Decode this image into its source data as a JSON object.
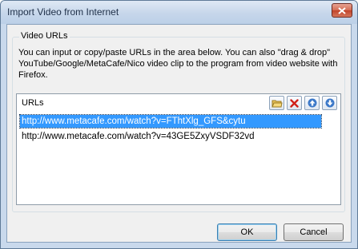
{
  "window": {
    "title": "Import Video from Internet",
    "close_icon": "close-icon"
  },
  "group": {
    "legend": "Video URLs",
    "description": "You can input or copy/paste URLs in the area below. You can also \"drag & drop\" YouTube/Google/MetaCafe/Nico video clip to the program from video website with Firefox."
  },
  "urls": {
    "header_label": "URLs",
    "toolbar": [
      {
        "name": "open-folder-icon"
      },
      {
        "name": "delete-icon"
      },
      {
        "name": "move-up-icon"
      },
      {
        "name": "move-down-icon"
      }
    ],
    "items": [
      {
        "text": "http://www.metacafe.com/watch?v=FThtXlg_GFS&cytu",
        "selected": true
      },
      {
        "text": "http://www.metacafe.com/watch?v=43GE5ZxyVSDF32vd",
        "selected": false
      }
    ]
  },
  "buttons": {
    "ok": "OK",
    "cancel": "Cancel"
  },
  "colors": {
    "selection": "#3399ff",
    "frame": "#c9d9ec",
    "dialog_bg": "#f0f0f0"
  }
}
